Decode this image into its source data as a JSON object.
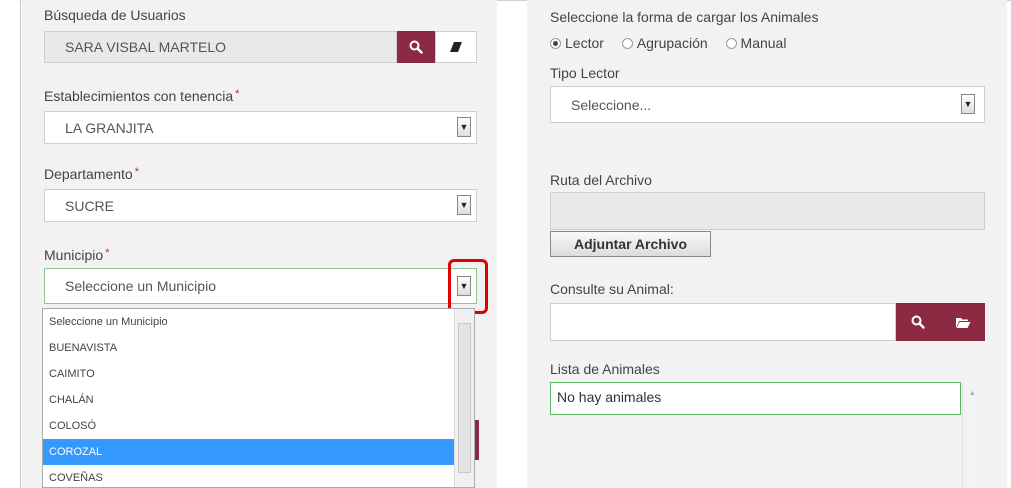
{
  "left": {
    "user_search": {
      "label": "Búsqueda de Usuarios",
      "value": "SARA VISBAL MARTELO"
    },
    "establishment": {
      "label": "Establecimientos con tenencia",
      "value": "LA GRANJITA"
    },
    "department": {
      "label": "Departamento",
      "value": "SUCRE"
    },
    "municipality": {
      "label": "Municipio",
      "value": "Seleccione un Municipio",
      "options": [
        "Seleccione un Municipio",
        "BUENAVISTA",
        "CAIMITO",
        "CHALÁN",
        "COLOSÓ",
        "COROZAL",
        "COVEÑAS"
      ],
      "highlighted": "COROZAL"
    },
    "required_marker": "*"
  },
  "right": {
    "load_mode": {
      "label": "Seleccione la forma de cargar los Animales",
      "options": [
        "Lector",
        "Agrupación",
        "Manual"
      ],
      "selected": "Lector"
    },
    "reader_type": {
      "label": "Tipo Lector",
      "value": "Seleccione..."
    },
    "file_path": {
      "label": "Ruta del Archivo",
      "value": ""
    },
    "attach_button": "Adjuntar Archivo",
    "animal_search": {
      "label": "Consulte su Animal:",
      "value": ""
    },
    "animal_list": {
      "label": "Lista de Animales",
      "value": "No hay animales"
    }
  },
  "icons": [
    "search-icon",
    "eraser-icon",
    "folder-open-icon",
    "chevron-down-icon"
  ],
  "colors": {
    "accent": "#8c2a43",
    "selection": "#3399ff",
    "required": "#b5302f",
    "focus_green": "#5cb85c",
    "highlight": "#e00000"
  }
}
